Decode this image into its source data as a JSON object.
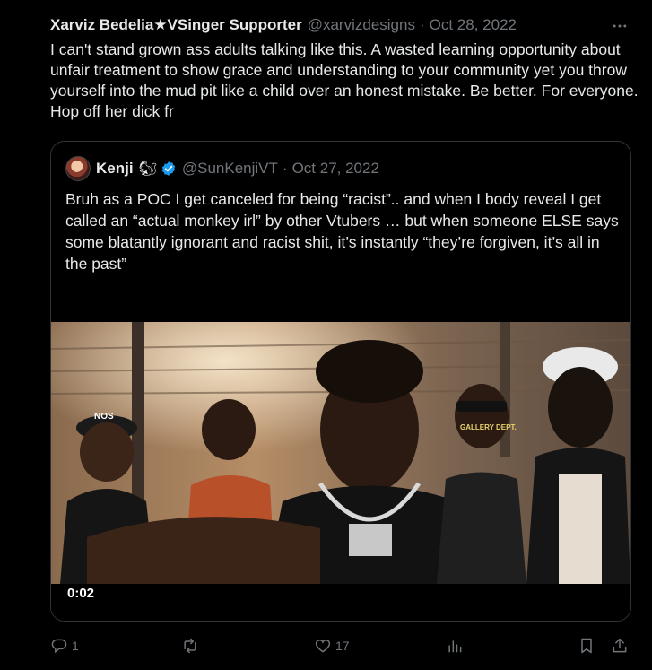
{
  "tweet": {
    "author_name": "Xarviz Bedelia★VSinger Supporter",
    "author_handle": "@xarvizdesigns",
    "separator": "·",
    "date": "Oct 28, 2022",
    "text": "I can't stand grown ass adults talking like this. A wasted learning opportunity about unfair treatment to show grace and understanding to your community yet you throw yourself into the mud pit like a child over an honest mistake. Be better. For everyone. Hop off her dick fr"
  },
  "quote": {
    "author_name": "Kenji",
    "emoji": "🐿",
    "author_handle": "@SunKenjiVT",
    "separator": "·",
    "date": "Oct 27, 2022",
    "text": "Bruh as a POC I get canceled for being “racist”.. and when I body reveal I get called an “actual monkey irl” by other Vtubers … but when someone ELSE says some blatantly ignorant and racist shit, it’s instantly “they’re forgiven, it’s all in the past”",
    "video": {
      "timestamp": "0:02",
      "cap_text_left": "NOS",
      "cap_text_right": "GALLERY DEPT."
    }
  },
  "actions": {
    "reply_count": "1",
    "retweet_count": "",
    "like_count": "17",
    "views_count": ""
  },
  "colors": {
    "background": "#000000",
    "text": "#e7e9ea",
    "muted": "#71767b",
    "border": "#2f3336",
    "verified": "#1d9bf0"
  },
  "icons": [
    "more-icon",
    "verified-icon",
    "reply-icon",
    "retweet-icon",
    "like-icon",
    "views-icon",
    "bookmark-icon",
    "share-icon"
  ]
}
